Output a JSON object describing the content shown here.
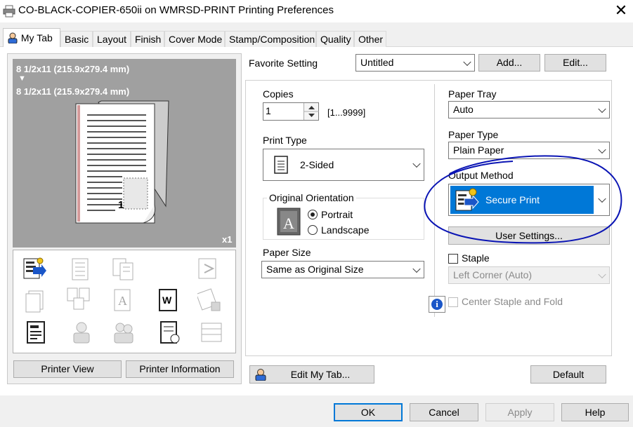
{
  "window": {
    "title": "CO-BLACK-COPIER-650ii on WMRSD-PRINT Printing Preferences",
    "close_label": "✕"
  },
  "tabs": [
    "My Tab",
    "Basic",
    "Layout",
    "Finish",
    "Cover Mode",
    "Stamp/Composition",
    "Quality",
    "Other"
  ],
  "preview": {
    "paper_top": "8 1/2x11 (215.9x279.4 mm)",
    "arrow": "▼",
    "paper_bottom": "8 1/2x11 (215.9x279.4 mm)",
    "page_number": "1",
    "copies_badge": "x1"
  },
  "left_buttons": {
    "printer_view": "Printer View",
    "printer_information": "Printer Information"
  },
  "favorite": {
    "label": "Favorite Setting",
    "value": "Untitled",
    "add": "Add...",
    "edit": "Edit..."
  },
  "copies": {
    "label": "Copies",
    "value": "1",
    "range": "[1...9999]"
  },
  "print_type": {
    "label": "Print Type",
    "value": "2-Sided"
  },
  "orientation": {
    "label": "Original Orientation",
    "portrait": "Portrait",
    "landscape": "Landscape",
    "selected": "Portrait"
  },
  "paper_size": {
    "label": "Paper Size",
    "value": "Same as Original Size"
  },
  "paper_tray": {
    "label": "Paper Tray",
    "value": "Auto"
  },
  "paper_type": {
    "label": "Paper Type",
    "value": "Plain Paper"
  },
  "output_method": {
    "label": "Output Method",
    "value": "Secure Print",
    "user_settings": "User Settings..."
  },
  "staple": {
    "label": "Staple",
    "value": "Left Corner (Auto)"
  },
  "center_staple": {
    "label": "Center Staple and Fold"
  },
  "info_icon_glyph": "i",
  "bottom": {
    "edit_my_tab": "Edit My Tab...",
    "default": "Default"
  },
  "dialog_buttons": {
    "ok": "OK",
    "cancel": "Cancel",
    "apply": "Apply",
    "help": "Help"
  },
  "colors": {
    "accent": "#0078d7",
    "highlight_circle": "#0a14b4",
    "preview_bg": "#a0a0a0"
  }
}
